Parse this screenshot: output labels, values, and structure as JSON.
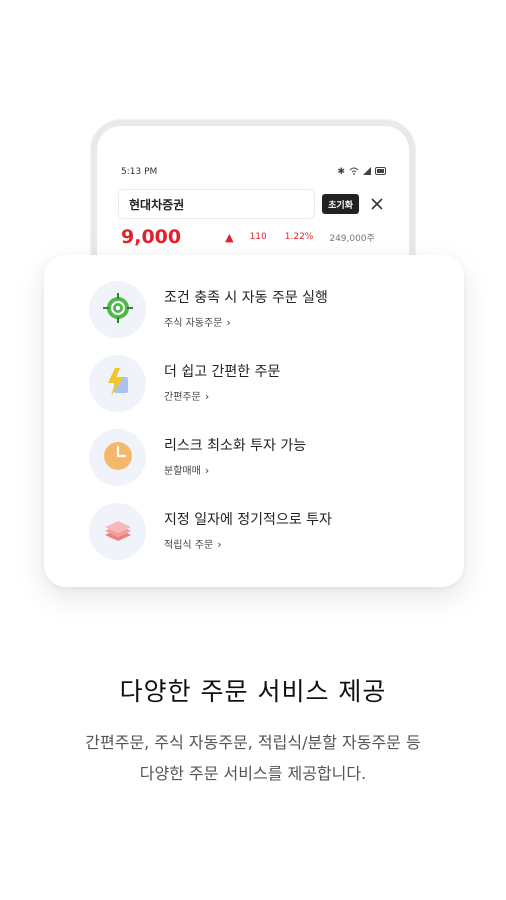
{
  "phone": {
    "status_time": "5:13 PM",
    "status_icons": [
      "bluetooth-icon",
      "wifi-icon",
      "signal-icon",
      "battery-icon"
    ],
    "search_value": "현대차증권",
    "reset_label": "초기화",
    "close_icon": "close-icon",
    "quote": {
      "price": "9,000",
      "arrow": "▲",
      "change": "110",
      "rate": "1.22%",
      "volume": "249,000주"
    }
  },
  "features": [
    {
      "title": "조건 충족 시 자동 주문 실행",
      "link": "주식 자동주문",
      "icon": "target-icon"
    },
    {
      "title": "더 쉽고 간편한 주문",
      "link": "간편주문",
      "icon": "lightning-icon"
    },
    {
      "title": "리스크 최소화 투자 가능",
      "link": "분할매매",
      "icon": "clock-icon"
    },
    {
      "title": "지정 일자에 정기적으로 투자",
      "link": "적립식 주문",
      "icon": "layers-icon"
    }
  ],
  "headline": "다양한 주문 서비스 제공",
  "description": {
    "line1": "간편주문, 주식 자동주문, 적립식/분할 자동주문 등",
    "line2": "다양한 주문 서비스를 제공합니다."
  },
  "colors": {
    "accent_red": "#e2222b",
    "icon_bg": "#f1f3fb"
  }
}
